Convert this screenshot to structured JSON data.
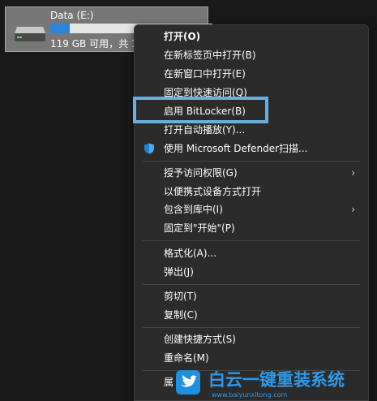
{
  "drive": {
    "name": "Data (E:)",
    "space_text": "119 GB 可用，共 1",
    "usage_fraction": 0.12,
    "icon": "hard-drive-icon"
  },
  "menu": {
    "items": [
      {
        "label": "打开(O)"
      },
      {
        "label": "在新标签页中打开(B)"
      },
      {
        "label": "在新窗口中打开(E)"
      },
      {
        "label": "固定到快速访问(Q)"
      },
      {
        "label": "启用 BitLocker(B)"
      },
      {
        "label": "打开自动播放(Y)..."
      },
      {
        "label": "使用 Microsoft Defender扫描...",
        "icon": "shield-icon"
      },
      {
        "label": "授予访问权限(G)",
        "submenu": true
      },
      {
        "label": "以便携式设备方式打开"
      },
      {
        "label": "包含到库中(I)",
        "submenu": true
      },
      {
        "label": "固定到\"开始\"(P)"
      },
      {
        "label": "格式化(A)..."
      },
      {
        "label": "弹出(J)"
      },
      {
        "label": "剪切(T)"
      },
      {
        "label": "复制(C)"
      },
      {
        "label": "创建快捷方式(S)"
      },
      {
        "label": "重命名(M)"
      },
      {
        "label": "属"
      }
    ],
    "submenu_glyph": "›"
  },
  "highlight_color": "#6aaee0",
  "accent": "#2b84d8",
  "watermark": {
    "title": "白云一键重装系统",
    "url": "www.baiyunxitong.com",
    "icon": "bird-logo-icon",
    "color": "#2f98e8"
  }
}
